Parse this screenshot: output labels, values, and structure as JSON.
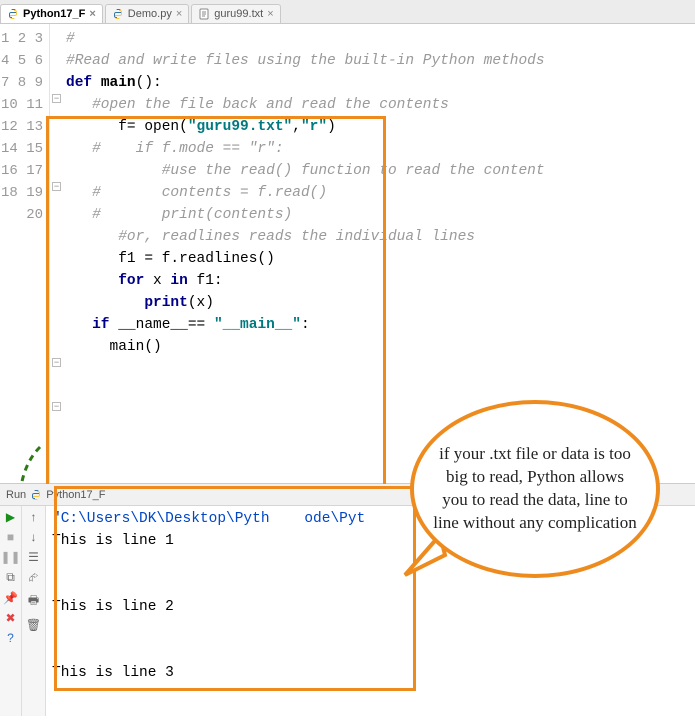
{
  "tabs": [
    {
      "label": "Python17_F",
      "icon": "python",
      "active": true
    },
    {
      "label": "Demo.py",
      "icon": "python",
      "active": false
    },
    {
      "label": "guru99.txt",
      "icon": "text",
      "active": false
    }
  ],
  "gutter_lines": [
    "1",
    "2",
    "3",
    "4",
    "5",
    "6",
    "7",
    "8",
    "9",
    "10",
    "11",
    "12",
    "13",
    "14",
    "15",
    "16",
    "17",
    "18",
    "19",
    "20"
  ],
  "code_lines": [
    {
      "tokens": [
        {
          "cls": "c-grey",
          "t": "#"
        }
      ]
    },
    {
      "tokens": [
        {
          "cls": "c-grey",
          "t": "#Read and write files using the built-in Python methods"
        }
      ]
    },
    {
      "tokens": [
        {
          "cls": "c-plain",
          "t": ""
        }
      ]
    },
    {
      "tokens": [
        {
          "cls": "c-kw",
          "t": "def "
        },
        {
          "cls": "c-fn",
          "t": "main"
        },
        {
          "cls": "c-plain",
          "t": "():"
        }
      ]
    },
    {
      "tokens": [
        {
          "cls": "c-plain",
          "t": ""
        }
      ]
    },
    {
      "tokens": [
        {
          "cls": "c-grey",
          "t": "   #open the file back and read the contents"
        }
      ]
    },
    {
      "tokens": [
        {
          "cls": "c-plain",
          "t": "      f= open("
        },
        {
          "cls": "c-str",
          "t": "\"guru99.txt\""
        },
        {
          "cls": "c-plain",
          "t": ","
        },
        {
          "cls": "c-str",
          "t": "\"r\""
        },
        {
          "cls": "c-plain",
          "t": ")"
        }
      ]
    },
    {
      "tokens": [
        {
          "cls": "c-grey",
          "t": "   #    if f.mode == \"r\":"
        }
      ]
    },
    {
      "tokens": [
        {
          "cls": "c-grey",
          "t": "           #use the read() function to read the content"
        }
      ]
    },
    {
      "tokens": [
        {
          "cls": "c-grey",
          "t": "   #       contents = f.read()"
        }
      ]
    },
    {
      "tokens": [
        {
          "cls": "c-grey",
          "t": "   #       print(contents)"
        }
      ]
    },
    {
      "tokens": [
        {
          "cls": "c-plain",
          "t": ""
        }
      ]
    },
    {
      "tokens": [
        {
          "cls": "c-grey",
          "t": "      #or, readlines reads the individual lines"
        }
      ]
    },
    {
      "tokens": [
        {
          "cls": "c-plain",
          "t": "      f1 = f.readlines()"
        }
      ]
    },
    {
      "tokens": [
        {
          "cls": "c-kw",
          "t": "      for "
        },
        {
          "cls": "c-plain",
          "t": "x"
        },
        {
          "cls": "c-kw",
          "t": " in "
        },
        {
          "cls": "c-plain",
          "t": "f1:"
        }
      ]
    },
    {
      "tokens": [
        {
          "cls": "c-plain",
          "t": "         "
        },
        {
          "cls": "c-kw",
          "t": "print"
        },
        {
          "cls": "c-plain",
          "t": "(x)"
        }
      ]
    },
    {
      "tokens": [
        {
          "cls": "c-plain",
          "t": ""
        }
      ]
    },
    {
      "tokens": [
        {
          "cls": "c-kw",
          "t": "   if "
        },
        {
          "cls": "c-plain",
          "t": "__name__== "
        },
        {
          "cls": "c-str",
          "t": "\"__main__\""
        },
        {
          "cls": "c-plain",
          "t": ":"
        }
      ]
    },
    {
      "tokens": [
        {
          "cls": "c-plain",
          "t": "     main()"
        }
      ]
    },
    {
      "tokens": [
        {
          "cls": "c-plain",
          "t": ""
        }
      ]
    }
  ],
  "run": {
    "tab_label": "Run",
    "config_label": "Python17_F",
    "path_text": "\"C:\\Users\\DK\\Desktop\\Pyth    ode\\Pyt",
    "output_lines": [
      "This is line 1",
      "",
      "",
      "This is line 2",
      "",
      "",
      "This is line 3"
    ]
  },
  "callout_text": "if your .txt file or data is too big to read, Python allows you to read the data, line to line without any complication",
  "colors": {
    "accent": "#ee8b1f"
  }
}
